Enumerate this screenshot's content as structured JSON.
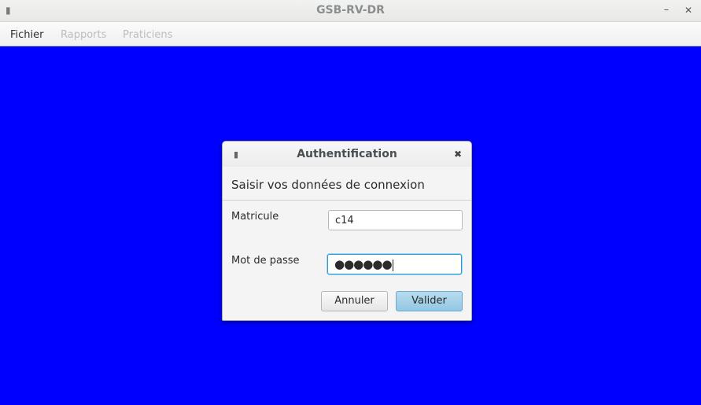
{
  "window": {
    "title": "GSB-RV-DR",
    "menu_icon": "window-menu-icon",
    "minimize_icon": "minimize-icon",
    "close_icon": "close-icon"
  },
  "menubar": {
    "items": [
      {
        "label": "Fichier",
        "enabled": true
      },
      {
        "label": "Rapports",
        "enabled": false
      },
      {
        "label": "Praticiens",
        "enabled": false
      }
    ]
  },
  "background_color": "#0000ff",
  "dialog": {
    "title": "Authentification",
    "header": "Saisir vos données de connexion",
    "fields": {
      "matricule": {
        "label": "Matricule",
        "value": "c14"
      },
      "password": {
        "label": "Mot de passe",
        "value": "●●●●●●"
      }
    },
    "buttons": {
      "cancel": "Annuler",
      "ok": "Valider"
    },
    "accent_color": "#2a9bd3"
  }
}
